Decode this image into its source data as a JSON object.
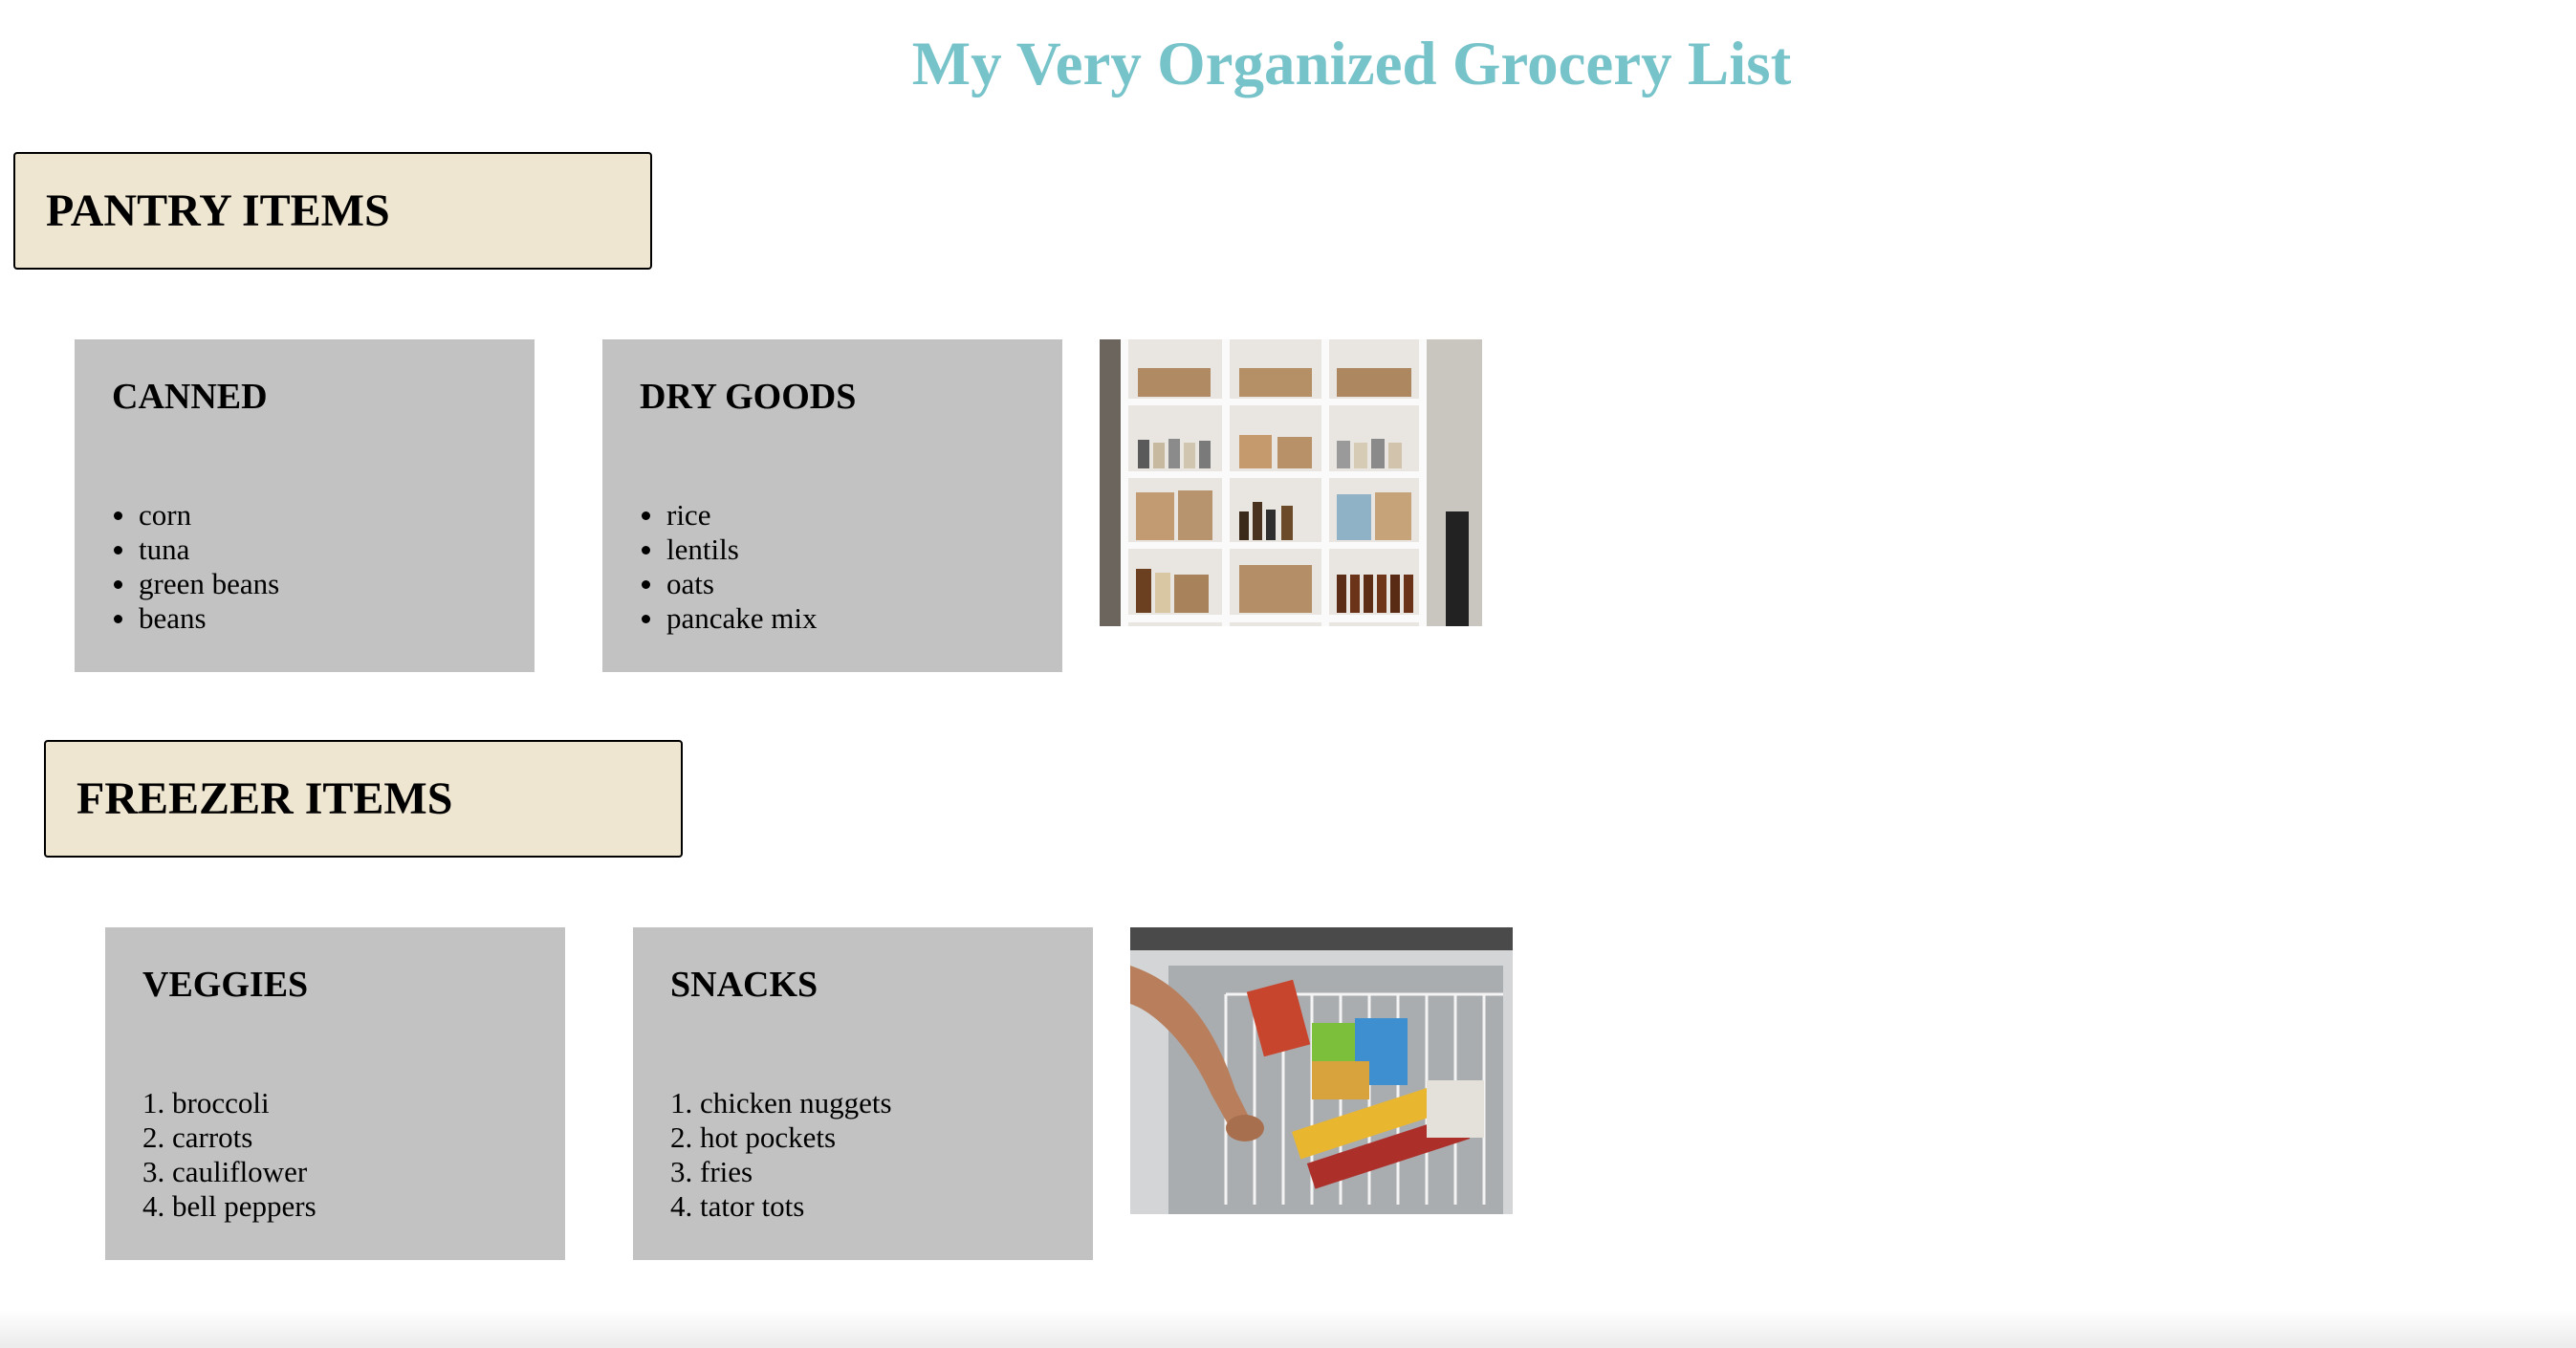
{
  "title": "My Very Organized Grocery List",
  "colors": {
    "title": "#77c3ca",
    "section_header_bg": "#efe6d2",
    "card_bg": "#c2c2c2"
  },
  "sections": [
    {
      "heading": "PANTRY ITEMS",
      "cards": [
        {
          "heading": "CANNED",
          "list_style": "bullet",
          "items": [
            "corn",
            "tuna",
            "green beans",
            "beans"
          ]
        },
        {
          "heading": "DRY GOODS",
          "list_style": "bullet",
          "items": [
            "rice",
            "lentils",
            "oats",
            "pancake mix"
          ]
        }
      ],
      "image": {
        "subject": "pantry-shelves-photo"
      }
    },
    {
      "heading": "FREEZER ITEMS",
      "cards": [
        {
          "heading": "VEGGIES",
          "list_style": "numbered",
          "items": [
            "broccoli",
            "carrots",
            "cauliflower",
            "bell peppers"
          ]
        },
        {
          "heading": "SNACKS",
          "list_style": "numbered",
          "items": [
            "chicken nuggets",
            "hot pockets",
            "fries",
            "tator tots"
          ]
        }
      ],
      "image": {
        "subject": "freezer-chest-photo"
      }
    }
  ]
}
